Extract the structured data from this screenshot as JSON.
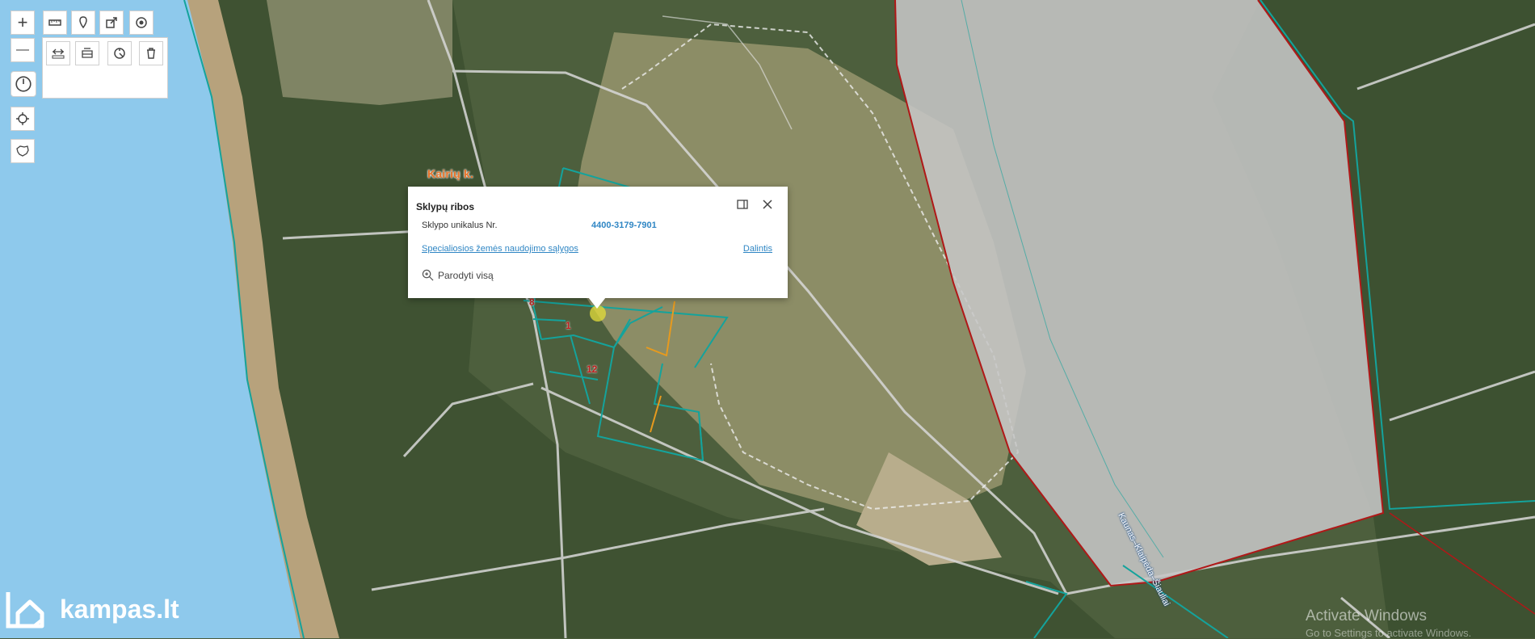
{
  "toolbar": {
    "zoom_in": "+",
    "zoom_out": "—",
    "tools_row1": [
      "ruler-icon",
      "marker-icon",
      "share-icon",
      "target-icon"
    ],
    "tools_row2": [
      "measure-distance-icon",
      "measure-area-icon",
      "measure-settings-icon",
      "trash-icon"
    ],
    "history_icon": "clock-icon",
    "locate_icon": "crosshair-icon",
    "country_icon": "lithuania-outline-icon"
  },
  "map": {
    "village_label": "Kairių k.",
    "parcel_numbers": [
      "8",
      "1",
      "12"
    ],
    "road_label": "Kaunas–Klaipėda–Šiauliai"
  },
  "popup": {
    "title": "Sklypų ribos",
    "field_label": "Sklypo unikalus Nr.",
    "field_value": "4400-3179-7901",
    "conditions_link": "Specialiosios žemės naudojimo sąlygos",
    "share_link": "Dalintis",
    "show_all": "Parodyti visą"
  },
  "branding": {
    "logo_text": "kampas.lt"
  },
  "watermark": {
    "line1": "Activate Windows",
    "line2": "Go to Settings to activate Windows."
  },
  "colors": {
    "water": "#8ec9ec",
    "parcel_outline": "#14a39c",
    "parcel_inner": "#e79a1e",
    "railway_zone": "#c6c6c6",
    "railway_border": "#b01818",
    "link": "#2f86c4"
  }
}
